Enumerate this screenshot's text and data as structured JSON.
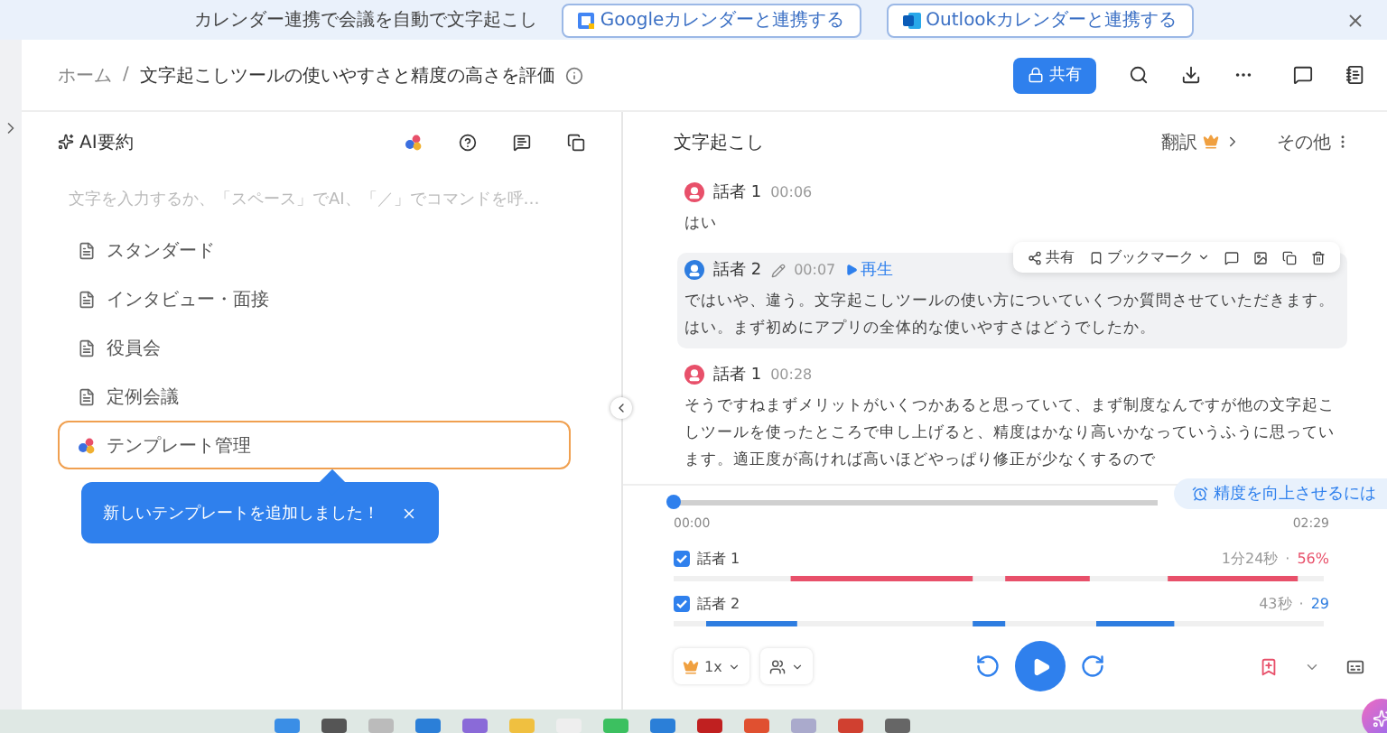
{
  "banner": {
    "text": "カレンダー連携で会議を自動で文字起こし",
    "buttons": [
      {
        "kind": "google",
        "label": "Googleカレンダーと連携する"
      },
      {
        "kind": "outlook",
        "label": "Outlookカレンダーと連携する"
      }
    ]
  },
  "breadcrumb": {
    "home": "ホーム",
    "separator": "/",
    "title": "文字起こしツールの使いやすさと精度の高さを評価"
  },
  "share_button": "共有",
  "left_panel": {
    "title": "AI要約",
    "placeholder": "文字を入力するか、「スペース」でAI、「／」でコマンドを呼…",
    "templates": [
      {
        "kind": "doc",
        "label": "スタンダード",
        "selected": false
      },
      {
        "kind": "doc",
        "label": "インタビュー・面接",
        "selected": false
      },
      {
        "kind": "doc",
        "label": "役員会",
        "selected": false
      },
      {
        "kind": "doc",
        "label": "定例会議",
        "selected": false
      },
      {
        "kind": "manage",
        "label": "テンプレート管理",
        "selected": true
      }
    ],
    "toast": "新しいテンプレートを追加しました！"
  },
  "right_panel": {
    "title": "文字起こし",
    "translate": "翻訳",
    "more": "その他",
    "entries": [
      {
        "speaker": "話者 1",
        "time": "00:06",
        "color": "#e8506a",
        "highlighted": false,
        "text": "はい"
      },
      {
        "speaker": "話者 2",
        "time": "00:07",
        "color": "#2e7de0",
        "highlighted": true,
        "play": "再生",
        "text": "ではいや、違う。文字起こしツールの使い方についていくつか質問させていただきます。はい。まず初めにアプリの全体的な使いやすさはどうでしたか。"
      },
      {
        "speaker": "話者 1",
        "time": "00:28",
        "color": "#e8506a",
        "highlighted": false,
        "text": "そうですねまずメリットがいくつかあると思っていて、まず制度なんですが他の文字起こしツールを使ったところで申し上げると、精度はかなり高いかなっていうふうに思っています。適正度が高ければ高いほどやっぱり修正が少なくするので"
      }
    ],
    "toolbar": {
      "share": "共有",
      "bookmark": "ブックマーク"
    },
    "tip": "精度を向上させるには"
  },
  "player": {
    "level": 0,
    "start": "00:00",
    "end": "02:29",
    "speed": "1x",
    "tracks": [
      {
        "name": "話者 1",
        "checked": true,
        "duration": "1分24秒",
        "separator": "·",
        "share": "56%",
        "color": "#e8506a"
      },
      {
        "name": "話者 2",
        "checked": true,
        "duration": "43秒",
        "separator": "·",
        "share": "29",
        "color": "#2e7de0"
      }
    ]
  }
}
